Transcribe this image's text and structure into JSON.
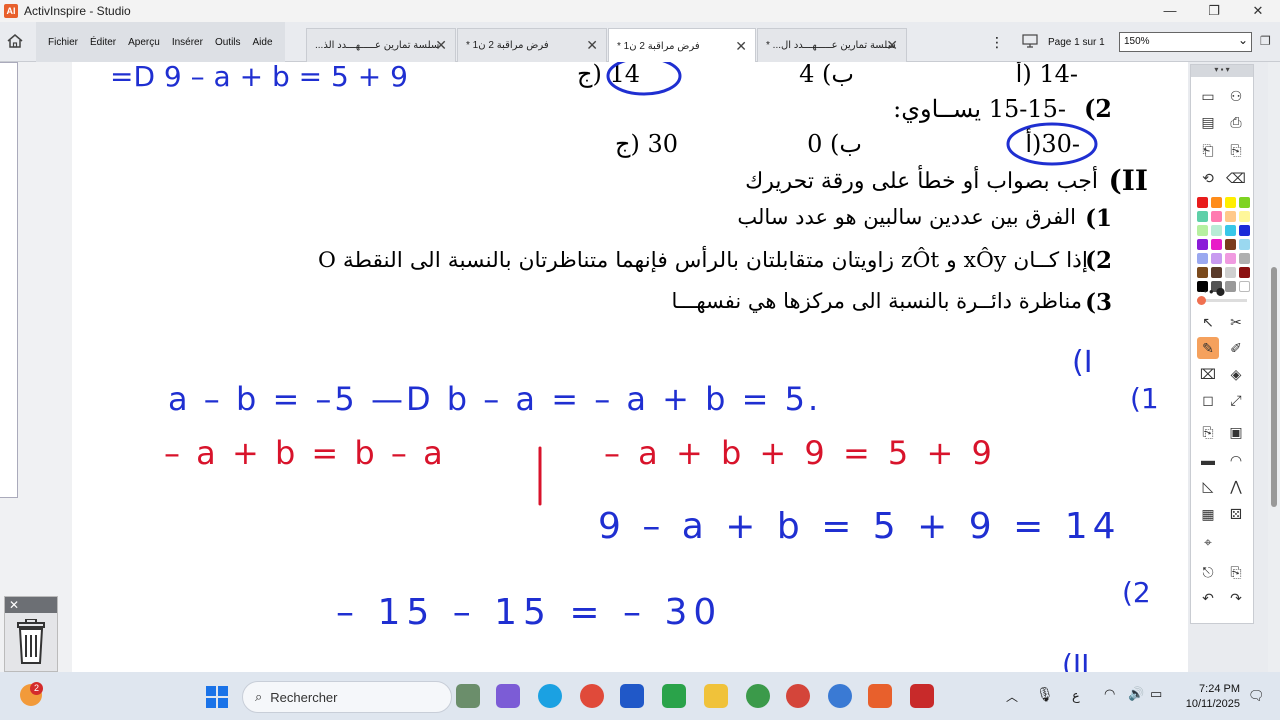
{
  "window": {
    "title": "ActivInspire - Studio",
    "controls": {
      "minimize": "—",
      "maximize": "❐",
      "close": "✕"
    }
  },
  "menu": {
    "items": [
      "Fichier",
      "Éditer",
      "Aperçu",
      "Insérer",
      "Outils",
      "Aide"
    ]
  },
  "tabs": [
    {
      "label": "...سلسة تمارين عـــــهـــدد الذ",
      "active": false
    },
    {
      "label": "* فرض مراقبة 2 ن1",
      "active": false
    },
    {
      "label": "* فرض مراقبة 2 ن1",
      "active": true
    },
    {
      "label": "* ...سلسة تمارين عـــــهـــدد ال",
      "active": false
    }
  ],
  "page": {
    "indicator": "Page 1 sur 1",
    "zoom": "150%"
  },
  "document": {
    "top_handwriting": "=D 9 – a + b = 5 + 9",
    "q1_options": {
      "c": "14 (ج",
      "b": "ب) 4",
      "a": "-14 (أ"
    },
    "q2_label": "2)",
    "q2_text": "-15-15  يســاوي:",
    "q2_options": {
      "c": "30 (ج",
      "b": "ب) 0",
      "a": "-30(أ"
    },
    "section_II": {
      "number": "II)",
      "title": "أجب بصواب أو خطأ على ورقة تحريرك"
    },
    "statements": [
      {
        "num": "1)",
        "text": "الفرق بين عددين سالبين هو عدد سالب"
      },
      {
        "num": "2)",
        "text": "إذا كــان  xÔy  و  zÔt  زاويتان متقابلتان بالرأس فإنهما متناظرتان بالنسبة الى النقطة O"
      },
      {
        "num": "3)",
        "text": "مناظرة دائــرة بالنسبة الى مركزها هي نفسهـــا"
      }
    ],
    "handwriting": {
      "line1_blue": "a – b = –5 —D b – a = – a + b = 5.",
      "line2_red_left": "– a + b = b – a",
      "line2_red_right": "– a + b + 9 = 5 + 9",
      "line3_blue": "9 – a + b = 5 + 9 = 14",
      "line4_blue": "– 15 – 15 = – 30",
      "margin_label_1": "(I",
      "margin_label_1b": "(1",
      "margin_label_2": "(2",
      "margin_label_3": "(II"
    }
  },
  "toolbox": {
    "colors": [
      "#e81c1c",
      "#ff8c1a",
      "#ffee00",
      "#7ed321",
      "#5ed0a8",
      "#ff7bb0",
      "#ffc98a",
      "#fff79a",
      "#b6f0a0",
      "#b8ecd6",
      "#38c7e8",
      "#1c2bd8",
      "#8a1cd8",
      "#e81cc8",
      "#7a3b1c",
      "#9ad8f0",
      "#9aa8f0",
      "#c89af0",
      "#f09ae0",
      "#b0b0b0",
      "#7a4a1c",
      "#5a3a2a",
      "#cfcfcf",
      "#8b1010",
      "#000000",
      "#555555",
      "#999999",
      "#ffffff"
    ]
  },
  "taskbar": {
    "search_placeholder": "Rechercher",
    "time": "7:24 PM",
    "date": "10/11/2025",
    "badge": "2",
    "lang": "ع"
  }
}
